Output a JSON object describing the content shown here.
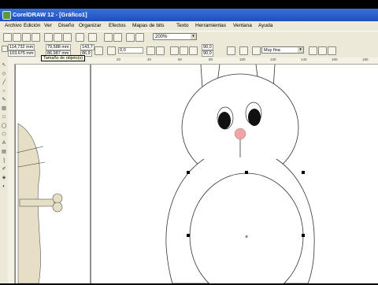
{
  "window": {
    "title": "CorelDRAW 12 - [Gráfico1]"
  },
  "menu": {
    "items": [
      "Archivo",
      "Edición",
      "Ver",
      "Diseño",
      "Organizar",
      "Efectos",
      "Mapas de bits",
      "Texto",
      "Herramientas",
      "Ventana",
      "Ayuda"
    ]
  },
  "toolbar": {
    "zoom_value": "200%",
    "zoom_arrow": "▾"
  },
  "propbar": {
    "x_value": "114,732 mm",
    "y_value": "103,675 mm",
    "width_value": "79,588 mm",
    "height_value": "86,987 mm",
    "scale_x": "143,7",
    "scale_y": "86,9",
    "angle_value": "0,0",
    "corner_1": "90,0",
    "corner_2": "90,0",
    "outline_width": "Muy fina"
  },
  "tooltip": {
    "text": "Tamaño de objeto(s)"
  },
  "ruler": {
    "ticks": [
      "20",
      "40",
      "60",
      "80",
      "100",
      "120",
      "140",
      "160",
      "180"
    ]
  },
  "colors": {
    "title_bar": "#1d4fc0",
    "chrome": "#ece9d8",
    "nose": "#f4a2a2",
    "bone": "#e6dfc6"
  },
  "icons": {
    "toolbox": [
      "pick-tool-icon",
      "shape-tool-icon",
      "knife-tool-icon",
      "zoom-tool-icon",
      "freehand-tool-icon",
      "smart-fill-icon",
      "rectangle-tool-icon",
      "ellipse-tool-icon",
      "polygon-tool-icon",
      "text-tool-icon",
      "interactive-fill-icon",
      "eyedropper-tool-icon",
      "outline-tool-icon",
      "fill-tool-icon",
      "interactive-blend-icon"
    ]
  }
}
